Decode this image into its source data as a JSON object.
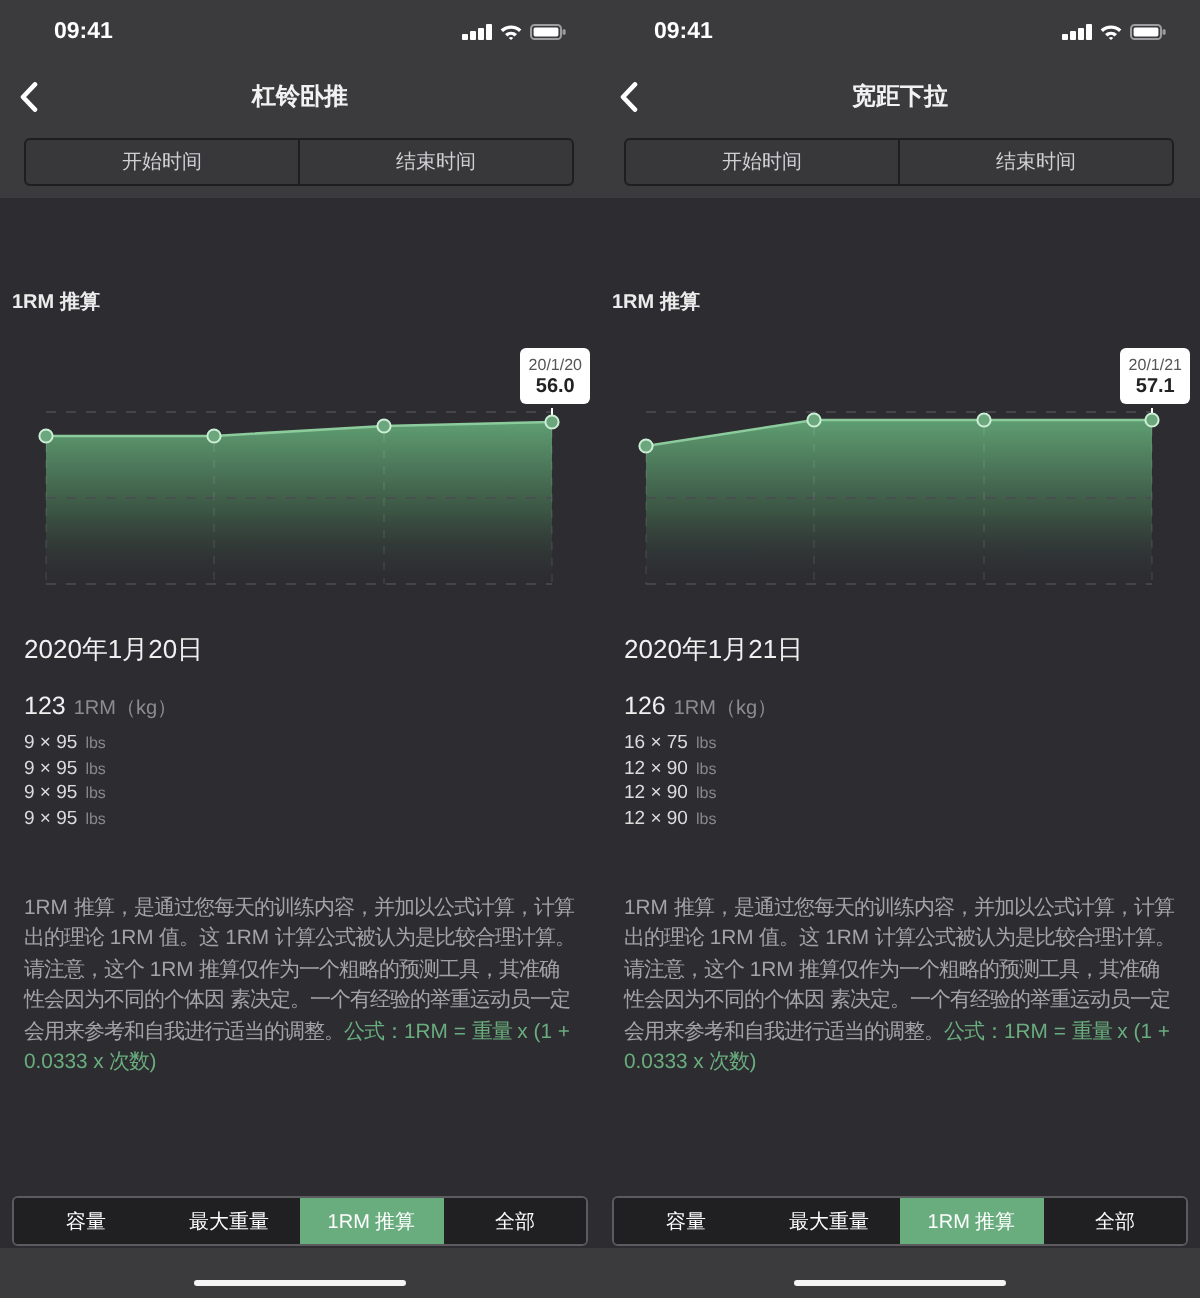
{
  "screens": [
    {
      "status_bar": {
        "time": "09:41"
      },
      "nav_bar": {
        "title": "杠铃卧推"
      },
      "time_filter": [
        {
          "label": "开始时间"
        },
        {
          "label": "结束时间"
        }
      ],
      "chart": {
        "title": "1RM 推算",
        "tooltip": {
          "date": "20/1/20",
          "value": "56.0"
        }
      },
      "record": {
        "date": "2020年1月20日",
        "total": "123",
        "total_unit": "1RM（kg）",
        "sets": [
          {
            "value": "9 × 95",
            "unit": "lbs"
          },
          {
            "value": "9 × 95",
            "unit": "lbs"
          },
          {
            "value": "9 × 95",
            "unit": "lbs"
          },
          {
            "value": "9 × 95",
            "unit": "lbs"
          }
        ]
      },
      "description": {
        "text": "1RM 推算，是通过您每天的训练内容，并加以公式计算，计算出的理论 1RM 值。这 1RM 计算公式被认为是比较合理计算。请注意，这个 1RM 推算仅作为一个粗略的预测工具，其准确性会因为不同的个体因 素决定。一个有经验的举重运动员一定会用来参考和自我进行适当的调整。",
        "formula": "公式：1RM = 重量 x (1 + 0.0333 x 次数)"
      },
      "bottom_tabs": [
        {
          "label": "容量",
          "selected": false
        },
        {
          "label": "最大重量",
          "selected": false
        },
        {
          "label": "1RM 推算",
          "selected": true
        },
        {
          "label": "全部",
          "selected": false
        }
      ]
    },
    {
      "status_bar": {
        "time": "09:41"
      },
      "nav_bar": {
        "title": "宽距下拉"
      },
      "time_filter": [
        {
          "label": "开始时间"
        },
        {
          "label": "结束时间"
        }
      ],
      "chart": {
        "title": "1RM 推算",
        "tooltip": {
          "date": "20/1/21",
          "value": "57.1"
        }
      },
      "record": {
        "date": "2020年1月21日",
        "total": "126",
        "total_unit": "1RM（kg）",
        "sets": [
          {
            "value": "16 × 75",
            "unit": "lbs"
          },
          {
            "value": "12 × 90",
            "unit": "lbs"
          },
          {
            "value": "12 × 90",
            "unit": "lbs"
          },
          {
            "value": "12 × 90",
            "unit": "lbs"
          }
        ]
      },
      "description": {
        "text": "1RM 推算，是通过您每天的训练内容，并加以公式计算，计算出的理论 1RM 值。这 1RM 计算公式被认为是比较合理计算。请注意，这个 1RM 推算仅作为一个粗略的预测工具，其准确性会因为不同的个体因 素决定。一个有经验的举重运动员一定会用来参考和自我进行适当的调整。",
        "formula": "公式：1RM = 重量 x (1 + 0.0333 x 次数)"
      },
      "bottom_tabs": [
        {
          "label": "容量",
          "selected": false
        },
        {
          "label": "最大重量",
          "selected": false
        },
        {
          "label": "1RM 推算",
          "selected": true
        },
        {
          "label": "全部",
          "selected": false
        }
      ]
    }
  ]
}
